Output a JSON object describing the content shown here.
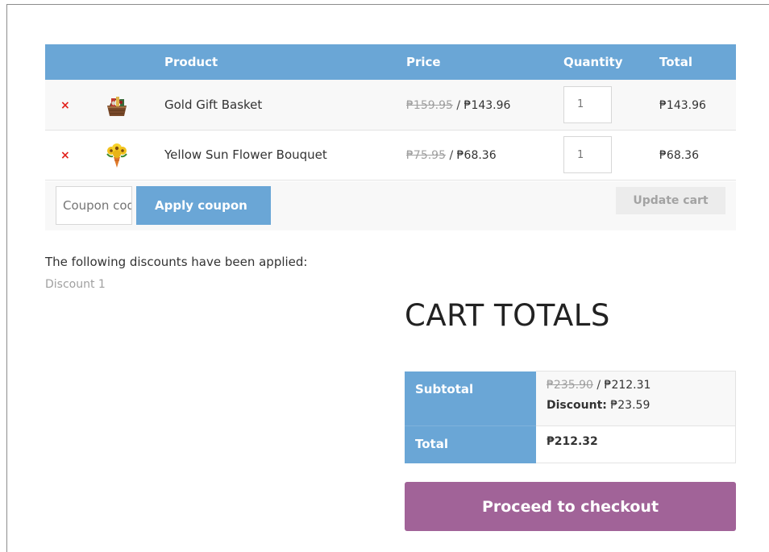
{
  "cart": {
    "headers": {
      "product": "Product",
      "price": "Price",
      "quantity": "Quantity",
      "total": "Total"
    },
    "remove_glyph": "×",
    "items": [
      {
        "name": "Gold Gift Basket",
        "old_price": "₱159.95",
        "separator": " / ",
        "new_price": "₱143.96",
        "quantity": "1",
        "line_total": "₱143.96",
        "thumb_icon": "gift-basket-icon"
      },
      {
        "name": "Yellow Sun Flower Bouquet",
        "old_price": "₱75.95",
        "separator": " / ",
        "new_price": "₱68.36",
        "quantity": "1",
        "line_total": "₱68.36",
        "thumb_icon": "flower-bouquet-icon"
      }
    ],
    "coupon": {
      "placeholder": "Coupon code",
      "apply_label": "Apply coupon"
    },
    "update_label": "Update cart"
  },
  "discounts": {
    "heading": "The following discounts have been applied:",
    "items": [
      "Discount 1"
    ]
  },
  "totals": {
    "title": "CART TOTALS",
    "subtotal_label": "Subtotal",
    "subtotal_old": "₱235.90",
    "subtotal_sep": " / ",
    "subtotal_new": "₱212.31",
    "discount_label": "Discount:",
    "discount_value": "₱23.59",
    "total_label": "Total",
    "total_value": "₱212.32"
  },
  "checkout": {
    "label": "Proceed to checkout"
  },
  "colors": {
    "accent_blue": "#6aa6d6",
    "checkout_purple": "#a16398",
    "remove_red": "#e2211c"
  }
}
